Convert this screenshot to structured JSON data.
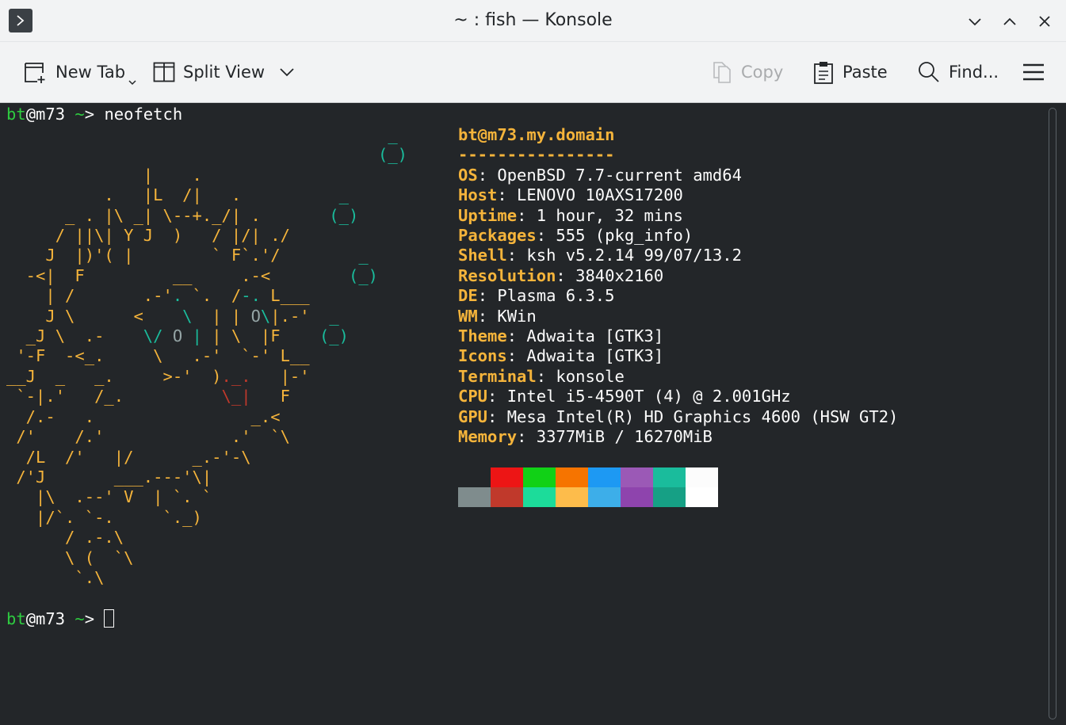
{
  "window": {
    "title": "~ : fish — Konsole"
  },
  "toolbar": {
    "new_tab": "New Tab",
    "split_view": "Split View",
    "copy": "Copy",
    "paste": "Paste",
    "find": "Find..."
  },
  "terminal": {
    "prompt1": {
      "user": "bt",
      "host": "@m73",
      "dir": " ~",
      "sym": "> ",
      "command": "neofetch"
    },
    "prompt2": {
      "user": "bt",
      "host": "@m73",
      "dir": " ~",
      "sym": "> "
    },
    "info": {
      "user_host": "bt@m73.my.domain",
      "separator": "----------------",
      "rows": [
        {
          "key": "OS",
          "value": ": OpenBSD 7.7-current amd64"
        },
        {
          "key": "Host",
          "value": ": LENOVO 10AXS17200"
        },
        {
          "key": "Uptime",
          "value": ": 1 hour, 32 mins"
        },
        {
          "key": "Packages",
          "value": ": 555 (pkg_info)"
        },
        {
          "key": "Shell",
          "value": ": ksh v5.2.14 99/07/13.2"
        },
        {
          "key": "Resolution",
          "value": ": 3840x2160"
        },
        {
          "key": "DE",
          "value": ": Plasma 6.3.5"
        },
        {
          "key": "WM",
          "value": ": KWin"
        },
        {
          "key": "Theme",
          "value": ": Adwaita [GTK3]"
        },
        {
          "key": "Icons",
          "value": ": Adwaita [GTK3]"
        },
        {
          "key": "Terminal",
          "value": ": konsole"
        },
        {
          "key": "CPU",
          "value": ": Intel i5-4590T (4) @ 2.001GHz"
        },
        {
          "key": "GPU",
          "value": ": Mesa Intel(R) HD Graphics 4600 (HSW GT2)"
        },
        {
          "key": "Memory",
          "value": ": 3377MiB / 16270MiB"
        }
      ]
    },
    "palette_top": [
      "#232629",
      "#ed1515",
      "#11d116",
      "#f67400",
      "#1d99f3",
      "#9b59b6",
      "#1abc9c",
      "#fcfcfc"
    ],
    "palette_bottom": [
      "#7f8c8d",
      "#c0392b",
      "#1cdc9a",
      "#fdbc4b",
      "#3daee9",
      "#8e44ad",
      "#16a085",
      "#ffffff"
    ]
  },
  "icons": {
    "app": "terminal-icon",
    "new_tab": "new-tab-icon",
    "split": "split-view-icon",
    "copy": "copy-icon",
    "paste": "paste-icon",
    "find": "search-icon",
    "menu": "hamburger-menu-icon"
  }
}
